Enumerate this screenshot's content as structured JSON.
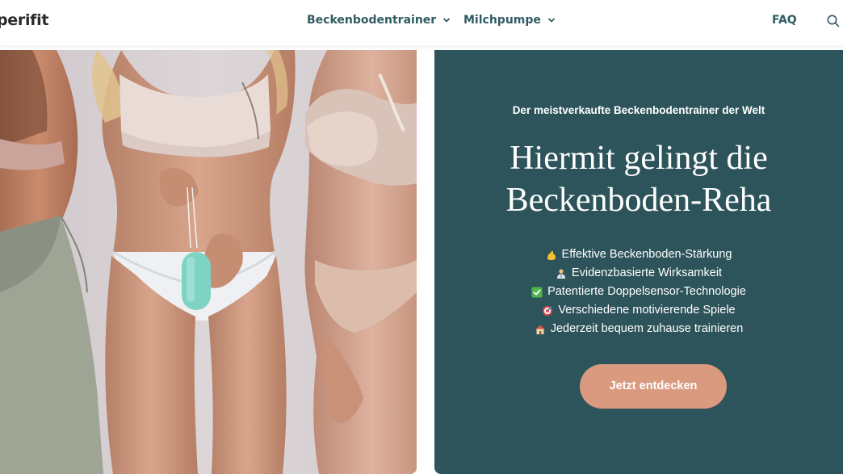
{
  "header": {
    "logo_text": "perifit",
    "nav": [
      {
        "label": "Beckenbodentrainer",
        "icon": "chevron-down-icon"
      },
      {
        "label": "Milchpumpe",
        "icon": "chevron-down-icon"
      }
    ],
    "faq_label": "FAQ",
    "search_icon": "search-icon"
  },
  "hero": {
    "eyebrow": "Der meistverkaufte Beckenbodentrainer der Welt",
    "headline_line1": "Hiermit gelingt die",
    "headline_line2": "Beckenboden-Reha",
    "features": [
      {
        "icon": "flexed-biceps-emoji",
        "text": "Effektive Beckenboden-Stärkung"
      },
      {
        "icon": "health-worker-emoji",
        "text": "Evidenzbasierte Wirksamkeit"
      },
      {
        "icon": "check-mark-emoji",
        "text": "Patentierte Doppelsensor-Technologie"
      },
      {
        "icon": "direct-hit-emoji",
        "text": "Verschiedene motivierende Spiele"
      },
      {
        "icon": "house-emoji",
        "text": "Jederzeit bequem zuhause trainieren"
      }
    ],
    "cta_label": "Jetzt entdecken"
  },
  "colors": {
    "hero_background": "#2d545a",
    "cta_background": "#d99a7f",
    "nav_text": "#2f5b62",
    "device_accent": "#7fd3c4"
  }
}
